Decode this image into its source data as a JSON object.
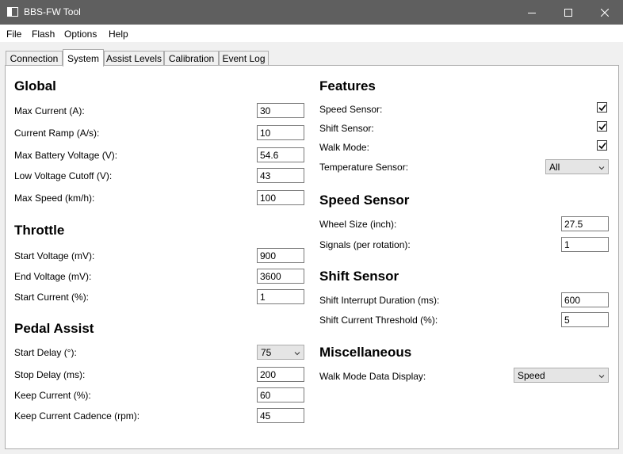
{
  "window": {
    "title": "BBS-FW Tool",
    "icon": "app-window-icon"
  },
  "menu": [
    "File",
    "Flash",
    "Options",
    "Help"
  ],
  "tabs": [
    {
      "label": "Connection",
      "active": false
    },
    {
      "label": "System",
      "active": true
    },
    {
      "label": "Assist Levels",
      "active": false
    },
    {
      "label": "Calibration",
      "active": false
    },
    {
      "label": "Event Log",
      "active": false
    }
  ],
  "global": {
    "heading": "Global",
    "fields": [
      {
        "label": "Max Current (A):",
        "value": "30"
      },
      {
        "label": "Current Ramp (A/s):",
        "value": "10"
      },
      {
        "label": "Max Battery Voltage (V):",
        "value": "54.6"
      },
      {
        "label": "Low Voltage Cutoff (V):",
        "value": "43"
      },
      {
        "label": "Max Speed (km/h):",
        "value": "100"
      }
    ]
  },
  "throttle": {
    "heading": "Throttle",
    "fields": [
      {
        "label": "Start Voltage (mV):",
        "value": "900"
      },
      {
        "label": "End Voltage (mV):",
        "value": "3600"
      },
      {
        "label": "Start Current (%):",
        "value": "1"
      }
    ]
  },
  "pedal_assist": {
    "heading": "Pedal Assist",
    "start_delay": {
      "label": "Start Delay (°):",
      "value": "75"
    },
    "fields": [
      {
        "label": "Stop Delay (ms):",
        "value": "200"
      },
      {
        "label": "Keep Current (%):",
        "value": "60"
      },
      {
        "label": "Keep Current Cadence (rpm):",
        "value": "45"
      }
    ]
  },
  "features": {
    "heading": "Features",
    "checks": [
      {
        "label": "Speed Sensor:",
        "checked": true
      },
      {
        "label": "Shift Sensor:",
        "checked": true
      },
      {
        "label": "Walk Mode:",
        "checked": true
      }
    ],
    "temperature": {
      "label": "Temperature Sensor:",
      "value": "All"
    }
  },
  "speed_sensor": {
    "heading": "Speed Sensor",
    "fields": [
      {
        "label": "Wheel Size (inch):",
        "value": "27.5"
      },
      {
        "label": "Signals (per rotation):",
        "value": "1"
      }
    ]
  },
  "shift_sensor": {
    "heading": "Shift Sensor",
    "fields": [
      {
        "label": "Shift Interrupt Duration (ms):",
        "value": "600"
      },
      {
        "label": "Shift Current Threshold (%):",
        "value": "5"
      }
    ]
  },
  "misc": {
    "heading": "Miscellaneous",
    "walk_display": {
      "label": "Walk Mode Data Display:",
      "value": "Speed"
    }
  }
}
